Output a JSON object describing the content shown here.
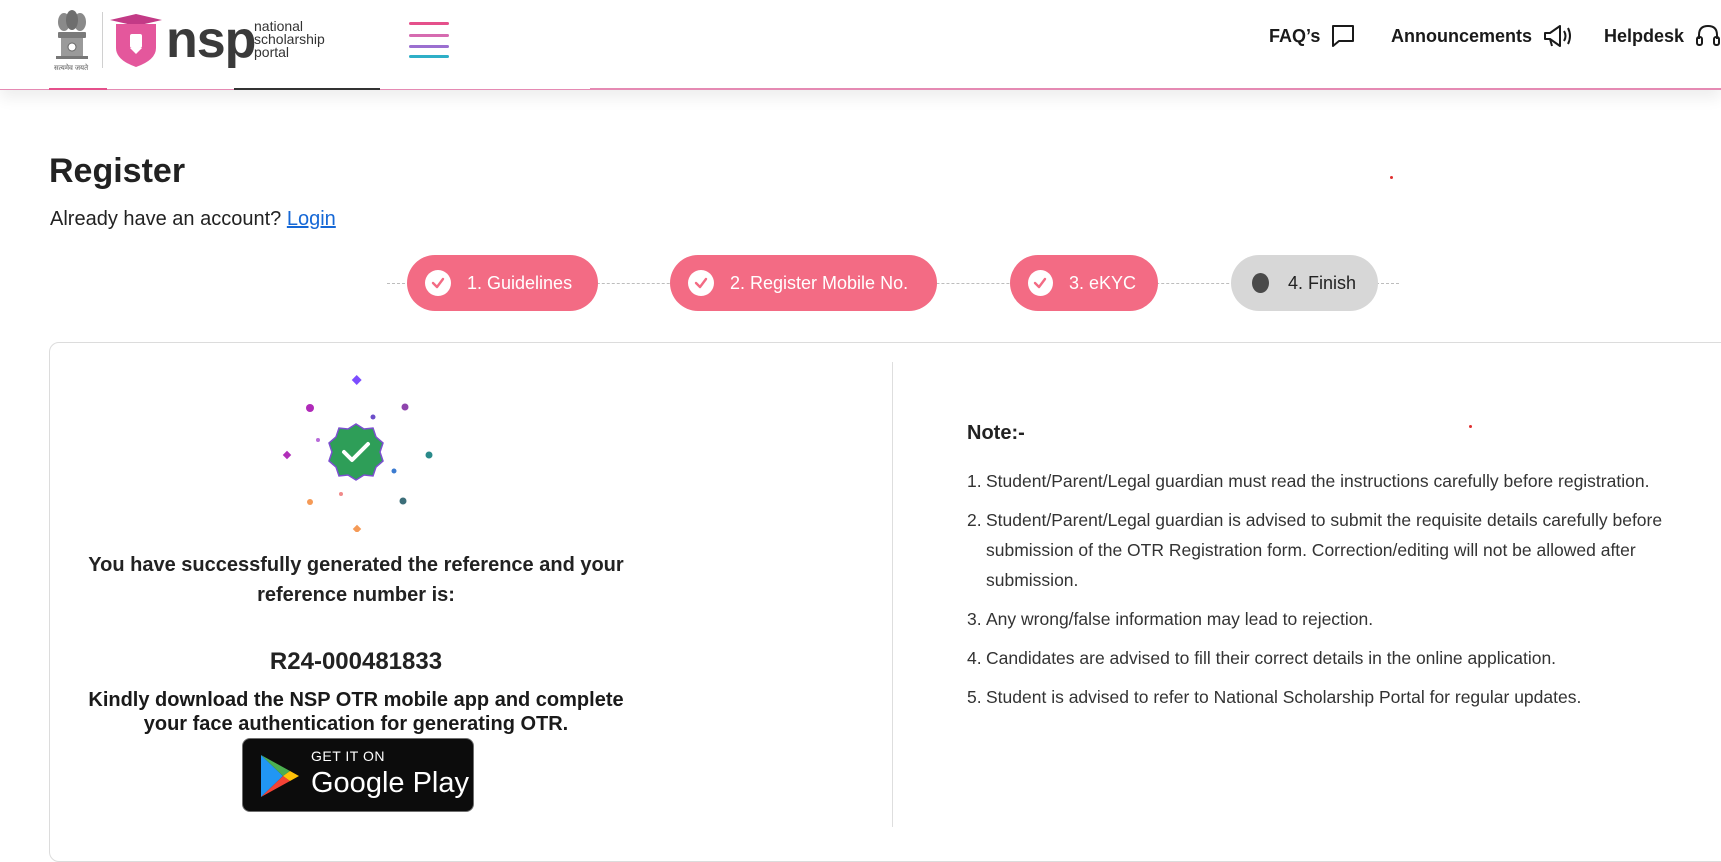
{
  "header": {
    "logo": {
      "emblem_caption": "सत्यमेव जयते",
      "brand": "nsp",
      "subtitle": [
        "national",
        "scholarship",
        "portal"
      ]
    },
    "menu_icon": "hamburger-icon",
    "nav": [
      {
        "label": "FAQ’s",
        "icon": "chat-icon"
      },
      {
        "label": "Announcements",
        "icon": "megaphone-icon"
      },
      {
        "label": "Helpdesk",
        "icon": "headset-icon"
      }
    ],
    "accent_colors": [
      "#e5508b",
      "#d66bb0",
      "#9b6fd0",
      "#2eafc7"
    ]
  },
  "page": {
    "title": "Register",
    "account_prompt": "Already have an account?",
    "login_link": "Login"
  },
  "stepper": {
    "steps": [
      {
        "label": "1. Guidelines",
        "status": "done"
      },
      {
        "label": "2. Register Mobile No.",
        "status": "done"
      },
      {
        "label": "3. eKYC",
        "status": "done"
      },
      {
        "label": "4. Finish",
        "status": "current"
      }
    ],
    "done_color": "#f36b84",
    "current_color": "#d7d7d7"
  },
  "success": {
    "icon": "verified-badge-icon",
    "message": "You have successfully generated the reference and your reference number is:",
    "reference_number": "R24-000481833",
    "download_message": "Kindly download the NSP OTR mobile app and complete your face authentication for generating OTR.",
    "store_badge": {
      "line1": "GET IT ON",
      "line2": "Google Play"
    }
  },
  "notes": {
    "title": "Note:-",
    "items": [
      "Student/Parent/Legal guardian must read the instructions carefully before registration.",
      "Student/Parent/Legal guardian is advised to submit the requisite details carefully before submission of the OTR Registration form. Correction/editing will not be allowed after submission.",
      "Any wrong/false information may lead to rejection.",
      "Candidates are advised to fill their correct details in the online application.",
      "Student is advised to refer to National Scholarship Portal for regular updates."
    ]
  }
}
